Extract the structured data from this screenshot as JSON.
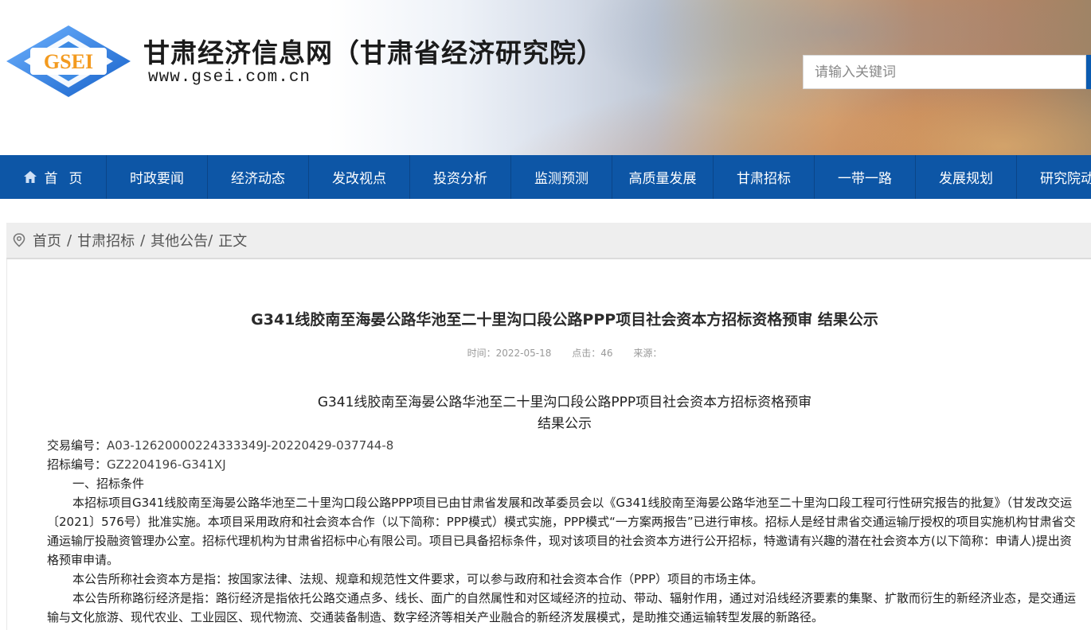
{
  "header": {
    "logo_text": "GSEI",
    "site_title": "甘肃经济信息网（甘肃省经济研究院）",
    "site_url": "www.gsei.com.cn",
    "search_placeholder": "请输入关键词"
  },
  "nav": {
    "home_label": "首页",
    "items": [
      "时政要闻",
      "经济动态",
      "发改视点",
      "投资分析",
      "监测预测",
      "高质量发展",
      "甘肃招标",
      "一带一路",
      "发展规划",
      "研究院动"
    ]
  },
  "breadcrumb": {
    "home": "首页",
    "section": "甘肃招标",
    "subsection": "其他公告",
    "current": "正文"
  },
  "article": {
    "title": "G341线胶南至海晏公路华池至二十里沟口段公路PPP项目社会资本方招标资格预审 结果公示",
    "time_label": "时间：2022-05-18",
    "clicks_label": "点击：46",
    "source_label": "来源：",
    "subtitle_line1": "G341线胶南至海晏公路华池至二十里沟口段公路PPP项目社会资本方招标资格预审",
    "subtitle_line2": "结果公示",
    "trade_no_label": "交易编号：",
    "trade_no": "A03-12620000224333349J-20220429-037744-8",
    "bid_no_label": "招标编号：",
    "bid_no": "GZ2204196-G341XJ",
    "section1": "一、招标条件",
    "para1": "本招标项目G341线胶南至海晏公路华池至二十里沟口段公路PPP项目已由甘肃省发展和改革委员会以《G341线胶南至海晏公路华池至二十里沟口段工程可行性研究报告的批复》（甘发改交运〔2021〕576号）批准实施。本项目采用政府和社会资本合作（以下简称：PPP模式）模式实施，PPP模式“一方案两报告”已进行审核。招标人是经甘肃省交通运输厅授权的项目实施机构甘肃省交通运输厅投融资管理办公室。招标代理机构为甘肃省招标中心有限公司。项目已具备招标条件，现对该项目的社会资本方进行公开招标，特邀请有兴趣的潜在社会资本方(以下简称：申请人)提出资格预审申请。",
    "para2": "本公告所称社会资本方是指：按国家法律、法规、规章和规范性文件要求，可以参与政府和社会资本合作（PPP）项目的市场主体。",
    "para3": "本公告所称路衍经济是指：路衍经济是指依托公路交通点多、线长、面广的自然属性和对区域经济的拉动、带动、辐射作用，通过对沿线经济要素的集聚、扩散而衍生的新经济业态，是交通运输与文化旅游、现代农业、工业园区、现代物流、交通装备制造、数字经济等相关产业融合的新经济发展模式，是助推交通运输转型发展的新路径。"
  },
  "colors": {
    "nav_bg": "#0d56a6",
    "logo_blue": "#2f7fd8",
    "logo_orange": "#f39a1e"
  }
}
